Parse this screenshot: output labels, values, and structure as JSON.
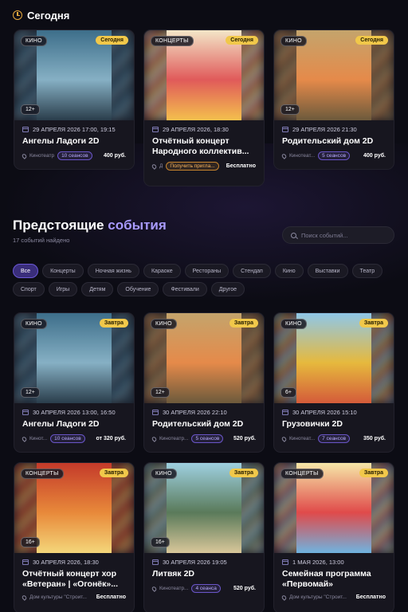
{
  "today": {
    "title": "Сегодня",
    "cards": [
      {
        "category": "КИНО",
        "when": "Сегодня",
        "age": "12+",
        "date": "29 АПРЕЛЯ 2026 17:00, 19:15",
        "title": "Ангелы Ладоги 2D",
        "venue": "Кинотеатр",
        "sessions": "10 сеансов",
        "price": "400 руб.",
        "session_style": "purple",
        "palette": [
          "#3d6e8a",
          "#86b0c4",
          "#2a3d4b"
        ]
      },
      {
        "category": "КОНЦЕРТЫ",
        "when": "Сегодня",
        "age": "",
        "date": "29 АПРЕЛЯ 2026, 18:30",
        "title": "Отчётный концерт Народного коллектив...",
        "venue": "Д",
        "sessions": "Получить пригла...",
        "price": "Бесплатно",
        "session_style": "orange",
        "palette": [
          "#f3e6c8",
          "#e05a5a",
          "#f4c04d"
        ]
      },
      {
        "category": "КИНО",
        "when": "Сегодня",
        "age": "12+",
        "date": "29 АПРЕЛЯ 2026 21:30",
        "title": "Родительский дом 2D",
        "venue": "Кинотеат...",
        "sessions": "5 сеансов",
        "price": "400 руб.",
        "session_style": "purple",
        "palette": [
          "#c4a46c",
          "#e58a4a",
          "#6c5a3c"
        ]
      }
    ]
  },
  "upcoming": {
    "title_main": "Предстоящие",
    "title_accent": "события",
    "count": "17 событий найдено",
    "search_placeholder": "Поиск событий...",
    "filters": [
      "Все",
      "Концерты",
      "Ночная жизнь",
      "Караоке",
      "Рестораны",
      "Стендап",
      "Кино",
      "Выставки",
      "Театр",
      "Спорт",
      "Игры",
      "Детям",
      "Обучение",
      "Фестивали",
      "Другое"
    ],
    "cards": [
      {
        "category": "КИНО",
        "when": "Завтра",
        "age": "12+",
        "date": "30 АПРЕЛЯ 2026 13:00, 16:50",
        "title": "Ангелы Ладоги 2D",
        "venue": "Кинот...",
        "sessions": "10 сеансов",
        "price": "от 320 руб.",
        "session_style": "purple",
        "palette": [
          "#3d6e8a",
          "#86b0c4",
          "#2a3d4b"
        ]
      },
      {
        "category": "КИНО",
        "when": "Завтра",
        "age": "12+",
        "date": "30 АПРЕЛЯ 2026 22:10",
        "title": "Родительский дом 2D",
        "venue": "Кинотеатр...",
        "sessions": "5 сеансов",
        "price": "520 руб.",
        "session_style": "purple",
        "palette": [
          "#c4a46c",
          "#e58a4a",
          "#6c5a3c"
        ]
      },
      {
        "category": "КИНО",
        "when": "Завтра",
        "age": "6+",
        "date": "30 АПРЕЛЯ 2026 15:10",
        "title": "Грузовички 2D",
        "venue": "Кинотеат...",
        "sessions": "7 сеансов",
        "price": "350 руб.",
        "session_style": "purple",
        "palette": [
          "#8fc7e8",
          "#e6b93d",
          "#d45b3a"
        ]
      },
      {
        "category": "КОНЦЕРТЫ",
        "when": "Завтра",
        "age": "16+",
        "date": "30 АПРЕЛЯ 2026, 18:30",
        "title": "Отчётный концерт хор «Ветеран» | «Огонёк»...",
        "venue": "Дом культуры \"Строит...",
        "sessions": "",
        "price": "Бесплатно",
        "session_style": "none",
        "palette": [
          "#c43a2a",
          "#e8893a",
          "#f4d67a"
        ]
      },
      {
        "category": "КИНО",
        "when": "Завтра",
        "age": "16+",
        "date": "30 АПРЕЛЯ 2026 19:05",
        "title": "Литвяк 2D",
        "venue": "Кинотеатр...",
        "sessions": "4 сеанса",
        "price": "520 руб.",
        "session_style": "purple",
        "palette": [
          "#9ed0e0",
          "#5a7a5a",
          "#d9c79a"
        ]
      },
      {
        "category": "КОНЦЕРТЫ",
        "when": "Завтра",
        "age": "",
        "date": "1 МАЯ 2026, 13:00",
        "title": "Семейная программа «Первомай»",
        "venue": "Дом культуры \"Строит...",
        "sessions": "",
        "price": "Бесплатно",
        "session_style": "none",
        "palette": [
          "#f6e7a8",
          "#e04a4a",
          "#6fb3e0"
        ]
      }
    ]
  },
  "colors": {
    "accent": "#a99bff",
    "badge": "#f1c84a",
    "clock": "#e9a93d"
  }
}
